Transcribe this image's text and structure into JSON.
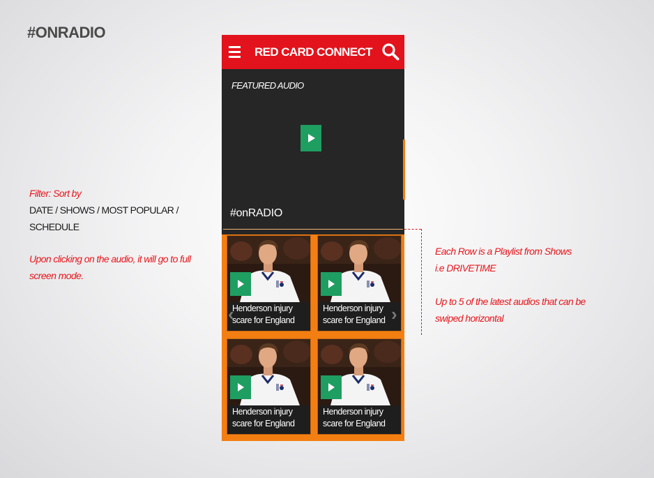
{
  "slide": {
    "title": "#ONRADIO"
  },
  "notes_left": {
    "filter_label": "Filter: Sort by",
    "filter_options_line1": "DATE / SHOWS / MOST POPULAR /",
    "filter_options_line2": "SCHEDULE",
    "click_note_line1": "Upon clicking on the audio, it will go to full",
    "click_note_line2": "screen mode."
  },
  "notes_right": {
    "row_note_line1": "Each Row is a Playlist from Shows",
    "row_note_line2": "i.e DRIVETIME",
    "swipe_note_line1": "Up to 5 of the latest audios that can be",
    "swipe_note_line2": "swiped horizontal"
  },
  "app": {
    "title": "RED CARD CONNECT",
    "featured_label": "FEATURED AUDIO",
    "section_label": "#onRADIO",
    "cards": [
      {
        "caption_line1": "Henderson injury",
        "caption_line2": "scare for England"
      },
      {
        "caption_line1": "Henderson injury",
        "caption_line2": "scare for England"
      },
      {
        "caption_line1": "Henderson injury",
        "caption_line2": "scare for England"
      },
      {
        "caption_line1": "Henderson injury",
        "caption_line2": "scare for England"
      }
    ],
    "prev_arrow": "‹",
    "next_arrow": "›"
  },
  "colors": {
    "topbar": "#e2131c",
    "accent_orange": "#f37f12",
    "play_green": "#1f9e62",
    "annotation_red": "#e8161b"
  }
}
